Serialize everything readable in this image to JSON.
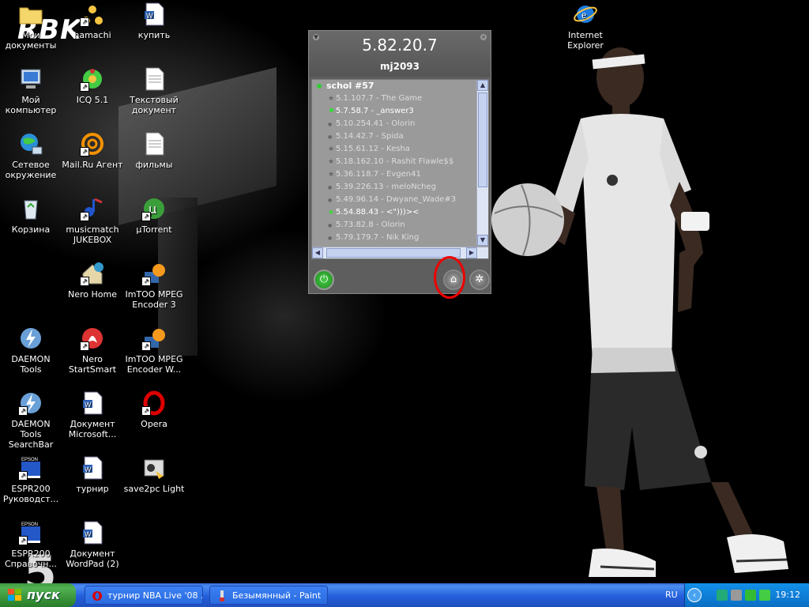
{
  "wallpaper": {
    "brand": "RBK",
    "jersey_number": "5"
  },
  "desktop_icons": [
    {
      "id": "my-docs",
      "label": "Мои документы",
      "icon": "folder-icon",
      "shortcut": false
    },
    {
      "id": "hamachi",
      "label": "hamachi",
      "icon": "hamachi-icon",
      "shortcut": true
    },
    {
      "id": "kupit",
      "label": "купить",
      "icon": "word-doc-icon",
      "shortcut": false
    },
    {
      "id": "ie",
      "label": "Internet Explorer",
      "icon": "internet-explorer-icon",
      "shortcut": false
    },
    {
      "id": "my-computer",
      "label": "Мой компьютер",
      "icon": "computer-icon",
      "shortcut": false
    },
    {
      "id": "icq",
      "label": "ICQ 5.1",
      "icon": "icq-flower-icon",
      "shortcut": true
    },
    {
      "id": "txt-doc",
      "label": "Текстовый документ",
      "icon": "text-document-icon",
      "shortcut": false
    },
    {
      "id": "network",
      "label": "Сетевое окружение",
      "icon": "network-globe-icon",
      "shortcut": false
    },
    {
      "id": "mailru",
      "label": "Mail.Ru Агент",
      "icon": "mailru-at-icon",
      "shortcut": true
    },
    {
      "id": "films",
      "label": "фильмы",
      "icon": "text-document-icon",
      "shortcut": false
    },
    {
      "id": "recycle",
      "label": "Корзина",
      "icon": "recycle-bin-icon",
      "shortcut": false
    },
    {
      "id": "musicmatch",
      "label": "musicmatch JUKEBOX",
      "icon": "musicmatch-icon",
      "shortcut": true
    },
    {
      "id": "utorrent",
      "label": "µTorrent",
      "icon": "utorrent-icon",
      "shortcut": true
    },
    {
      "id": "nero-home",
      "label": "Nero Home",
      "icon": "nero-home-icon",
      "shortcut": true
    },
    {
      "id": "imtoo3",
      "label": "ImTOO MPEG Encoder 3",
      "icon": "imtoo-encoder-icon",
      "shortcut": true
    },
    {
      "id": "daemon",
      "label": "DAEMON Tools",
      "icon": "daemon-tools-icon",
      "shortcut": false
    },
    {
      "id": "nero-ss",
      "label": "Nero StartSmart",
      "icon": "nero-startsmart-icon",
      "shortcut": true
    },
    {
      "id": "imtoo-w",
      "label": "ImTOO MPEG Encoder W...",
      "icon": "imtoo-encoder-icon",
      "shortcut": true
    },
    {
      "id": "daemon-sb",
      "label": "DAEMON Tools SearchBar",
      "icon": "daemon-tools-icon",
      "shortcut": true
    },
    {
      "id": "doc-ms",
      "label": "Документ Microsoft...",
      "icon": "word-doc-icon",
      "shortcut": false
    },
    {
      "id": "opera",
      "label": "Opera",
      "icon": "opera-icon",
      "shortcut": true
    },
    {
      "id": "espr200",
      "label": "ESPR200 Руководст...",
      "icon": "epson-book-icon",
      "shortcut": true
    },
    {
      "id": "turnir",
      "label": "турнир",
      "icon": "word-doc-icon",
      "shortcut": false
    },
    {
      "id": "save2pc",
      "label": "save2pc Light",
      "icon": "save2pc-icon",
      "shortcut": false
    },
    {
      "id": "espr200-sprav",
      "label": "ESPR200 Справочн...",
      "icon": "epson-book-icon",
      "shortcut": true
    },
    {
      "id": "doc-wordpad",
      "label": "Документ WordPad (2)",
      "icon": "word-doc-icon",
      "shortcut": false
    }
  ],
  "widget": {
    "ip": "5.82.20.7",
    "user": "mj2093",
    "group": "schol #57",
    "members": [
      {
        "text": "5.1.107.7 - The Game",
        "status": "star"
      },
      {
        "text": "5.7.58.7 - _answer3",
        "status": "online"
      },
      {
        "text": "5.10.254.41 - Olorin",
        "status": "offline"
      },
      {
        "text": "5.14.42.7 - Spida",
        "status": "offline"
      },
      {
        "text": "5.15.61.12 - Kesha",
        "status": "star"
      },
      {
        "text": "5.18.162.10 - Rashit Flawle$$",
        "status": "star"
      },
      {
        "text": "5.36.118.7 - Evgen41",
        "status": "star"
      },
      {
        "text": "5.39.226.13 - meloNcheg",
        "status": "offline"
      },
      {
        "text": "5.49.96.14 - Dwyane_Wade#3",
        "status": "offline"
      },
      {
        "text": "5.54.88.43 - <\")))><",
        "status": "online-star"
      },
      {
        "text": "5.73.82.8 - Olorin",
        "status": "offline"
      },
      {
        "text": "5.79.179.7 - Nik King",
        "status": "offline"
      }
    ],
    "buttons": {
      "power": "power-icon",
      "network": "network-icon",
      "settings": "gear-icon"
    }
  },
  "taskbar": {
    "start_label": "пуск",
    "tasks": [
      {
        "label": "турнир NBA Live '08 ...",
        "icon": "opera-icon"
      },
      {
        "label": "Безымянный - Paint",
        "icon": "paint-icon"
      }
    ],
    "language": "RU",
    "clock": "19:12"
  }
}
